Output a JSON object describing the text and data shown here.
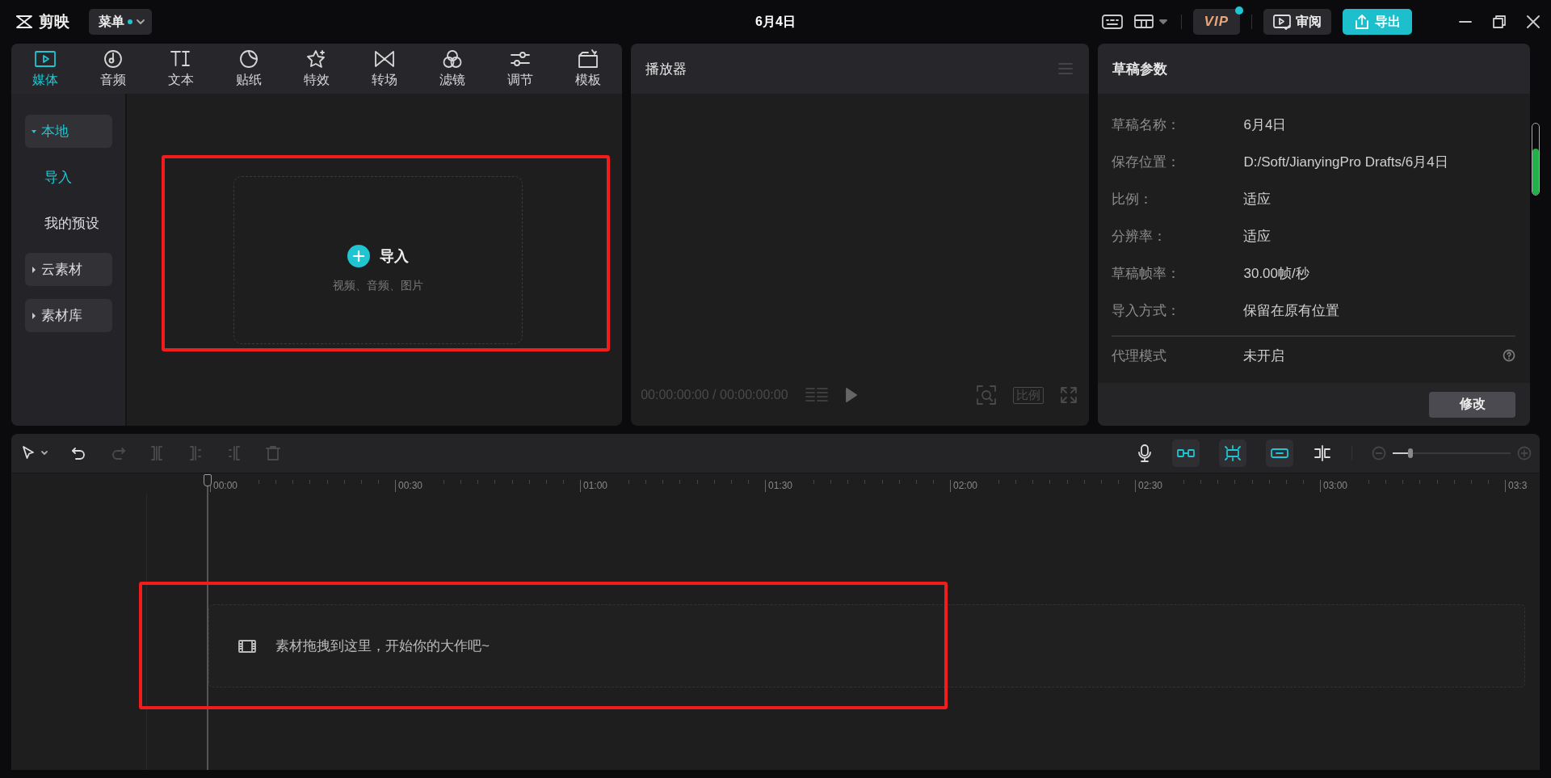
{
  "app": {
    "name": "剪映",
    "menu": "菜单",
    "menu_badge": true,
    "title": "6月4日",
    "vip": "VIP",
    "vip_badge": true,
    "review": "审阅",
    "export": "导出"
  },
  "media_tabs": [
    {
      "label": "媒体",
      "kind": "media",
      "selected": true
    },
    {
      "label": "音频",
      "kind": "audio",
      "selected": false
    },
    {
      "label": "文本",
      "kind": "text",
      "selected": false
    },
    {
      "label": "贴纸",
      "kind": "sticker",
      "selected": false
    },
    {
      "label": "特效",
      "kind": "effect",
      "selected": false
    },
    {
      "label": "转场",
      "kind": "transition",
      "selected": false
    },
    {
      "label": "滤镜",
      "kind": "filter",
      "selected": false
    },
    {
      "label": "调节",
      "kind": "adjust",
      "selected": false
    },
    {
      "label": "模板",
      "kind": "template",
      "selected": false
    }
  ],
  "sidebar": [
    {
      "label": "本地",
      "kind": "group",
      "expanded": true,
      "selected": true
    },
    {
      "label": "导入",
      "kind": "item",
      "selected": true
    },
    {
      "label": "我的预设",
      "kind": "item",
      "selected": false
    },
    {
      "label": "云素材",
      "kind": "group",
      "expanded": false,
      "selected": false
    },
    {
      "label": "素材库",
      "kind": "group",
      "expanded": false,
      "selected": false
    }
  ],
  "import_area": {
    "label": "导入",
    "hint": "视频、音频、图片",
    "highlighted": true
  },
  "player": {
    "title": "播放器",
    "timecode": "00:00:00:00 / 00:00:00:00",
    "ratio": "比例"
  },
  "draft_params": {
    "title": "草稿参数",
    "rows": [
      {
        "label": "草稿名称：",
        "value": "6月4日"
      },
      {
        "label": "保存位置：",
        "value": "D:/Soft/JianyingPro Drafts/6月4日"
      },
      {
        "label": "比例：",
        "value": "适应"
      },
      {
        "label": "分辨率：",
        "value": "适应"
      },
      {
        "label": "草稿帧率：",
        "value": "30.00帧/秒"
      },
      {
        "label": "导入方式：",
        "value": "保留在原有位置"
      }
    ],
    "proxy": {
      "label": "代理模式",
      "value": "未开启"
    },
    "button": "修改"
  },
  "timeline": {
    "tools": [
      {
        "kind": "select",
        "disabled": false
      },
      {
        "kind": "undo",
        "disabled": false
      },
      {
        "kind": "redo",
        "disabled": true
      },
      {
        "kind": "split",
        "disabled": true
      },
      {
        "kind": "split_left",
        "disabled": true
      },
      {
        "kind": "split_right",
        "disabled": true
      },
      {
        "kind": "delete",
        "disabled": true
      }
    ],
    "snap_tools": [
      {
        "kind": "main_track",
        "on": true
      },
      {
        "kind": "auto_snap",
        "on": true
      },
      {
        "kind": "linkage",
        "on": true
      },
      {
        "kind": "preview_axis",
        "on": false
      }
    ],
    "zoom": {
      "level": 0.15
    },
    "ruler": [
      "00:00",
      "00:30",
      "01:00",
      "01:30",
      "02:00",
      "02:30",
      "03:00",
      "03:3"
    ],
    "drop_hint": "素材拖拽到这里，开始你的大作吧~",
    "highlighted": true
  }
}
